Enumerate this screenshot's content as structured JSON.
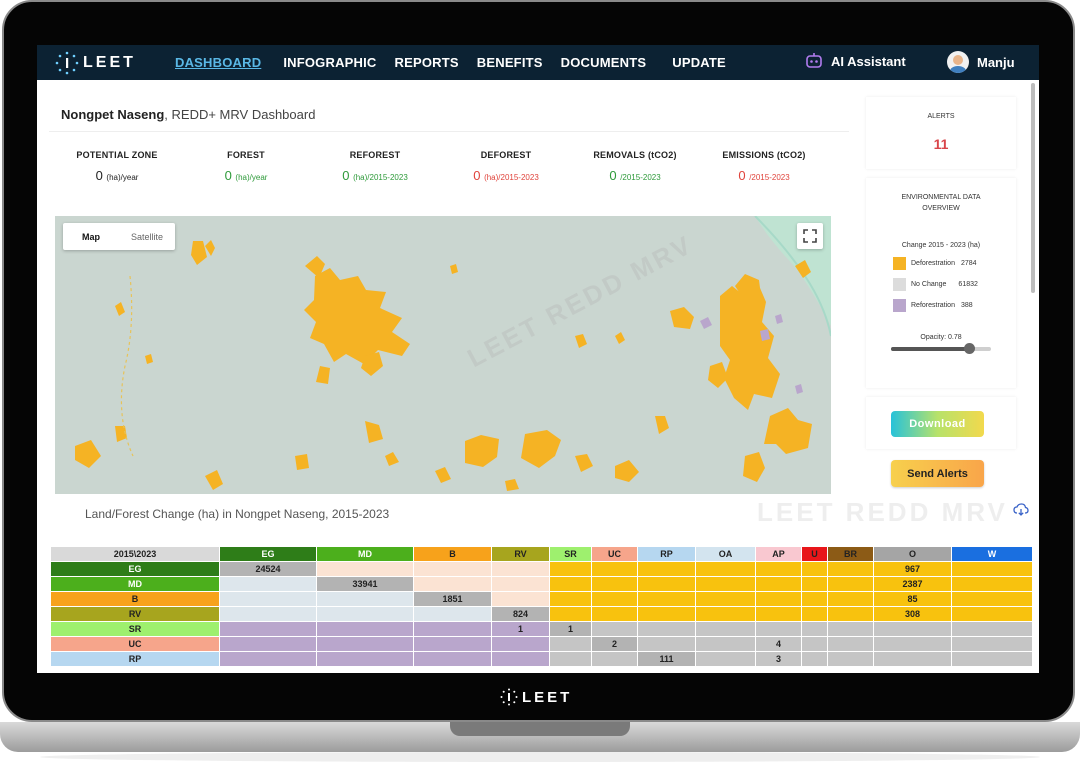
{
  "nav": {
    "brand": "LEET",
    "links": [
      "DASHBOARD",
      "INFOGRAPHIC",
      "REPORTS",
      "BENEFITS",
      "DOCUMENTS",
      "UPDATE"
    ],
    "assistant": "AI Assistant",
    "user": "Manju"
  },
  "header": {
    "location": "Nongpet Naseng",
    "subtitle": ", REDD+ MRV Dashboard"
  },
  "stats": [
    {
      "title": "POTENTIAL ZONE",
      "value": "0",
      "unit": "(ha)/year",
      "tone": "dark"
    },
    {
      "title": "FOREST",
      "value": "0",
      "unit": "(ha)/year",
      "tone": "green"
    },
    {
      "title": "REFOREST",
      "value": "0",
      "unit": "(ha)/2015-2023",
      "tone": "green"
    },
    {
      "title": "DEFOREST",
      "value": "0",
      "unit": "(ha)/2015-2023",
      "tone": "red"
    },
    {
      "title": "REMOVALS (tCO2)",
      "value": "0",
      "unit": "/2015-2023",
      "tone": "green"
    },
    {
      "title": "EMISSIONS (tCO2)",
      "value": "0",
      "unit": "/2015-2023",
      "tone": "red"
    }
  ],
  "map": {
    "tab_map": "Map",
    "tab_satellite": "Satellite",
    "watermark": "LEET REDD MRV"
  },
  "table_title": "Land/Forest Change (ha) in Nongpet Naseng, 2015-2023",
  "table_watermark": "LEET REDD MRV",
  "change_table": {
    "corner": "2015\\2023",
    "columns": [
      {
        "code": "EG",
        "color": "#2e7d18",
        "text": "#ffffff"
      },
      {
        "code": "MD",
        "color": "#4caf1c",
        "text": "#ffffff"
      },
      {
        "code": "B",
        "color": "#f7a21b",
        "text": "#222222"
      },
      {
        "code": "RV",
        "color": "#a7a51e",
        "text": "#222222"
      },
      {
        "code": "SR",
        "color": "#9ef06e",
        "text": "#222222"
      },
      {
        "code": "UC",
        "color": "#f6a58b",
        "text": "#222222"
      },
      {
        "code": "RP",
        "color": "#b6d7f0",
        "text": "#222222"
      },
      {
        "code": "OA",
        "color": "#d3e4ef",
        "text": "#222222"
      },
      {
        "code": "AP",
        "color": "#f9c8d0",
        "text": "#222222"
      },
      {
        "code": "U",
        "color": "#e8161a",
        "text": "#222222"
      },
      {
        "code": "BR",
        "color": "#8c5b16",
        "text": "#222222"
      },
      {
        "code": "O",
        "color": "#a5a5a5",
        "text": "#222222"
      },
      {
        "code": "W",
        "color": "#1a6fe0",
        "text": "#ffffff"
      }
    ],
    "rows": [
      {
        "code": "EG",
        "color": "#2e7d18",
        "cells": [
          "24524",
          "",
          "",
          "",
          "",
          "",
          "",
          "",
          "",
          "",
          "",
          "967",
          ""
        ]
      },
      {
        "code": "MD",
        "color": "#4caf1c",
        "cells": [
          "",
          "33941",
          "",
          "",
          "",
          "",
          "",
          "",
          "",
          "",
          "",
          "2387",
          ""
        ]
      },
      {
        "code": "B",
        "color": "#f7a21b",
        "cells": [
          "",
          "",
          "1851",
          "",
          "",
          "",
          "",
          "",
          "",
          "",
          "",
          "85",
          ""
        ]
      },
      {
        "code": "RV",
        "color": "#a7a51e",
        "cells": [
          "",
          "",
          "",
          "824",
          "",
          "",
          "",
          "",
          "",
          "",
          "",
          "308",
          ""
        ]
      },
      {
        "code": "SR",
        "color": "#9ef06e",
        "cells": [
          "",
          "",
          "",
          "1",
          "1",
          "",
          "",
          "",
          "",
          "",
          "",
          "",
          ""
        ]
      },
      {
        "code": "UC",
        "color": "#f6a58b",
        "cells": [
          "",
          "",
          "",
          "",
          "",
          "2",
          "",
          "",
          "4",
          "",
          "",
          "",
          ""
        ]
      },
      {
        "code": "RP",
        "color": "#b6d7f0",
        "cells": [
          "",
          "",
          "",
          "",
          "",
          "",
          "111",
          "",
          "3",
          "",
          "",
          "",
          ""
        ]
      }
    ]
  },
  "alerts": {
    "label": "ALERTS",
    "count": "11"
  },
  "env": {
    "title_1": "ENVIRONMENTAL DATA",
    "title_2": "OVERVIEW",
    "subtitle": "Change 2015 - 2023 (ha)",
    "legend": [
      {
        "label": "Deforestration",
        "value": "2784",
        "color": "#f5b324"
      },
      {
        "label": "No Change",
        "value": "61832",
        "color": "#dcdcdc"
      },
      {
        "label": "Reforestration",
        "value": "388",
        "color": "#b9a6cc"
      }
    ],
    "opacity_label": "Opacity: 0.78",
    "opacity": 0.78
  },
  "buttons": {
    "download": "Download",
    "send_alerts": "Send Alerts"
  },
  "footer_brand": "LEET",
  "colors": {
    "nav_bg": "#0c2233",
    "active_link": "#5ab8e6",
    "map_bg": "#cad6d0",
    "deforest_patch": "#f5b324",
    "diag_grey": "#b3b3b3",
    "upper_blue": "#dde6ec",
    "upper_peach": "#fbe3d3",
    "upper_yellow": "#f8c20e",
    "lower_purple": "#b9a6cc",
    "lower_grey": "#c5c5c5"
  }
}
